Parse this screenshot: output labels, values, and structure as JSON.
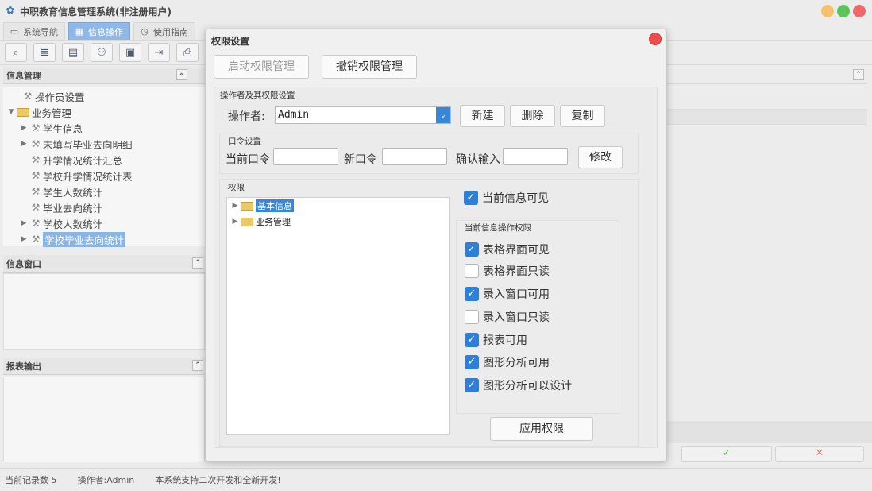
{
  "app": {
    "title": "中职教育信息管理系统(非注册用户)"
  },
  "tabs": [
    {
      "label": "系统导航"
    },
    {
      "label": "信息操作"
    },
    {
      "label": "使用指南"
    }
  ],
  "left": {
    "info_mgmt": {
      "title": "信息管理",
      "items": [
        {
          "label": "操作员设置"
        },
        {
          "label": "业务管理"
        },
        {
          "label": "学生信息"
        },
        {
          "label": "未填写毕业去向明细"
        },
        {
          "label": "升学情况统计汇总"
        },
        {
          "label": "学校升学情况统计表"
        },
        {
          "label": "学生人数统计"
        },
        {
          "label": "毕业去向统计"
        },
        {
          "label": "学校人数统计"
        },
        {
          "label": "学校毕业去向统计"
        }
      ]
    },
    "info_window": {
      "title": "信息窗口"
    },
    "report_output": {
      "title": "报表输出"
    }
  },
  "status": {
    "records": "当前记录数 5",
    "operator": "操作者:Admin",
    "note": "本系统支持二次开发和全新开发!"
  },
  "dialog": {
    "title": "权限设置",
    "enable_btn": "启动权限管理",
    "revoke_btn": "撤销权限管理",
    "operator_group": {
      "title": "操作者及其权限设置",
      "operator_label": "操作者:",
      "operator_value": "Admin",
      "new_btn": "新建",
      "delete_btn": "删除",
      "copy_btn": "复制"
    },
    "password_group": {
      "title": "口令设置",
      "current_label": "当前口令",
      "new_label": "新口令",
      "confirm_label": "确认输入",
      "modify_btn": "修改"
    },
    "perm_group": {
      "title": "权限",
      "tree": [
        {
          "label": "基本信息"
        },
        {
          "label": "业务管理"
        }
      ],
      "visible_label": "当前信息可见",
      "ops_title": "当前信息操作权限",
      "ops": [
        {
          "label": "表格界面可见",
          "checked": true
        },
        {
          "label": "表格界面只读",
          "checked": false
        },
        {
          "label": "录入窗口可用",
          "checked": true
        },
        {
          "label": "录入窗口只读",
          "checked": false
        },
        {
          "label": "报表可用",
          "checked": true
        },
        {
          "label": "图形分析可用",
          "checked": true
        },
        {
          "label": "图形分析可以设计",
          "checked": true
        }
      ],
      "apply_btn": "应用权限"
    }
  }
}
